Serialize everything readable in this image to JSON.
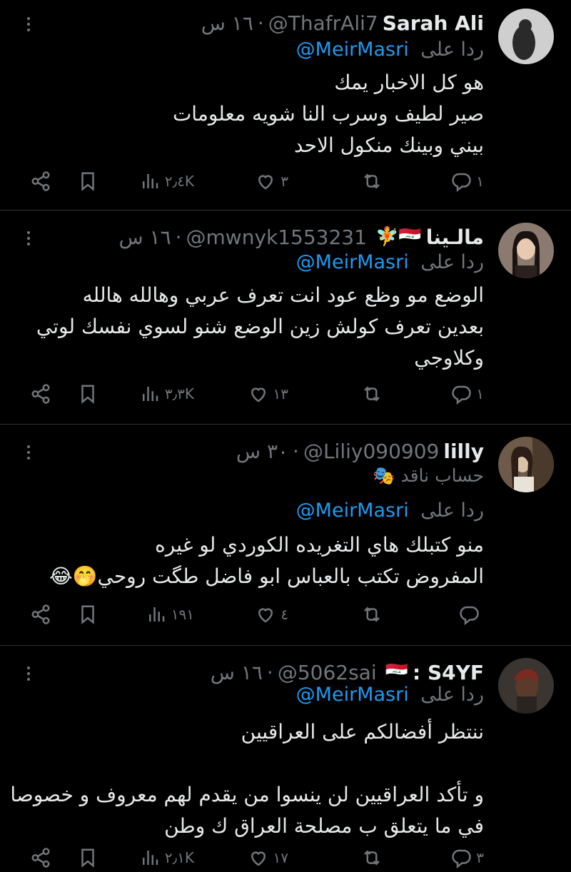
{
  "tweets": [
    {
      "name": "Sarah Ali",
      "handle": "@ThafrAli7",
      "time": "١٦ س",
      "flag": "",
      "reply_label": "ردا على",
      "reply_mention": "@MeirMasri",
      "badge": "",
      "lines": [
        "هو كل الاخبار يمك",
        "صير لطيف وسرب النا شويه معلومات",
        "بيني وبينك منكول الاحد"
      ],
      "replies": "١",
      "retweets": "",
      "likes": "٣",
      "views": "٢٫٤K"
    },
    {
      "name": "مالـينا",
      "handle": "@mwnyk1553231",
      "time": "١٦ س",
      "flag": "🇮🇶🧚",
      "reply_label": "ردا على",
      "reply_mention": "@MeirMasri",
      "badge": "",
      "lines": [
        "الوضع مو وظع عود انت تعرف عربي وهالله هالله",
        "بعدين تعرف كولش زين الوضع شنو لسوي نفسك لوتي",
        "وكلاوجي"
      ],
      "replies": "١",
      "retweets": "",
      "likes": "١٣",
      "views": "٣٫٣K"
    },
    {
      "name": "lilly",
      "handle": "@Liliy090909",
      "time": "٣٠ س",
      "flag": "",
      "reply_label": "ردا على",
      "reply_mention": "@MeirMasri",
      "badge": "حساب ناقد 🎭",
      "lines": [
        "منو كتبلك هاي التغريده الكوردي لو غيره",
        "المفروض تكتب بالعباس ابو فاضل طگت روحي🤭😂"
      ],
      "replies": "",
      "retweets": "",
      "likes": "٤",
      "views": "١٩١"
    },
    {
      "name": "S4YF :",
      "handle": "@5062sai",
      "time": "١٦ س",
      "flag": "🇮🇶",
      "reply_label": "ردا على",
      "reply_mention": "@MeirMasri",
      "badge": "",
      "lines": [
        "ننتظر أفضالكم على العراقيين",
        "",
        "و تأكد العراقيين لن ينسوا من يقدم لهم معروف و خصوصا",
        "في ما يتعلق ب مصلحة العراق ك وطن"
      ],
      "replies": "٣",
      "retweets": "",
      "likes": "١٧",
      "views": "٢٫١K"
    }
  ],
  "icons": {
    "reply": "reply-icon",
    "retweet": "retweet-icon",
    "like": "like-icon",
    "views": "views-icon",
    "bookmark": "bookmark-icon",
    "share": "share-icon",
    "more": "more-icon"
  },
  "colors": {
    "background": "#000000",
    "text": "#e7e9ea",
    "muted": "#71767b",
    "link": "#1d9bf0",
    "divider": "#2f3336"
  }
}
